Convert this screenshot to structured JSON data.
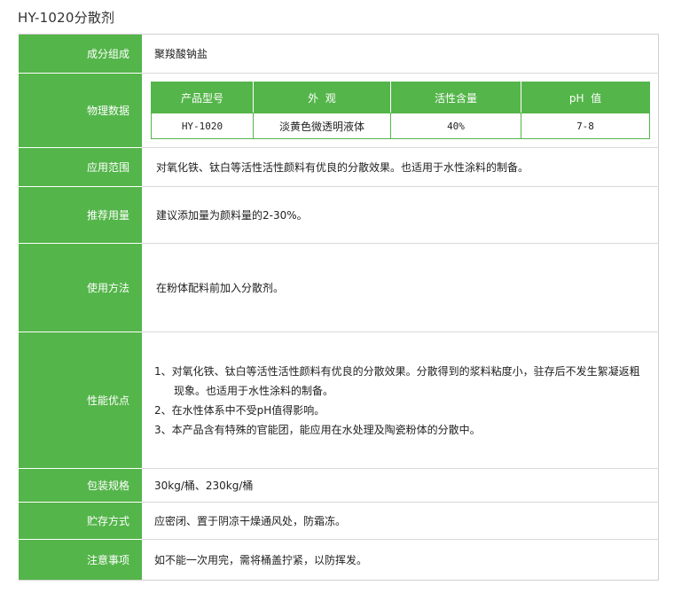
{
  "page_title": "HY-1020分散剂",
  "rows": {
    "composition": {
      "label": "成分组成",
      "value": "聚羧酸钠盐"
    },
    "physical": {
      "label": "物理数据",
      "table": {
        "headers": [
          "产品型号",
          "外  观",
          "活性含量",
          "pH  值"
        ],
        "cells": [
          "HY-1020",
          "淡黄色微透明液体",
          "40%",
          "7-8"
        ]
      }
    },
    "application": {
      "label": "应用范围",
      "value": "对氧化铁、钛白等活性活性颜料有优良的分散效果。也适用于水性涂料的制备。"
    },
    "dosage": {
      "label": "推荐用量",
      "value": "建议添加量为颜料量的2-30%。"
    },
    "usage": {
      "label": "使用方法",
      "value": "在粉体配料前加入分散剂。"
    },
    "advantages": {
      "label": "性能优点",
      "lines": [
        "1、对氧化铁、钛白等活性活性颜料有优良的分散效果。分散得到的浆料粘度小，驻存后不发生絮凝返粗",
        "现象。也适用于水性涂料的制备。",
        "2、在水性体系中不受pH值得影响。",
        "3、本产品含有特殊的官能团，能应用在水处理及陶瓷粉体的分散中。"
      ]
    },
    "packaging": {
      "label": "包装规格",
      "value": "30kg/桶、230kg/桶"
    },
    "storage": {
      "label": "贮存方式",
      "value": "应密闭、置于阴凉干燥通风处，防霜冻。"
    },
    "notes": {
      "label": "注意事项",
      "value": "如不能一次用完，需将桶盖拧紧，以防挥发。"
    }
  },
  "colors": {
    "accent": "#54b54a",
    "border": "#cfcfcf"
  }
}
